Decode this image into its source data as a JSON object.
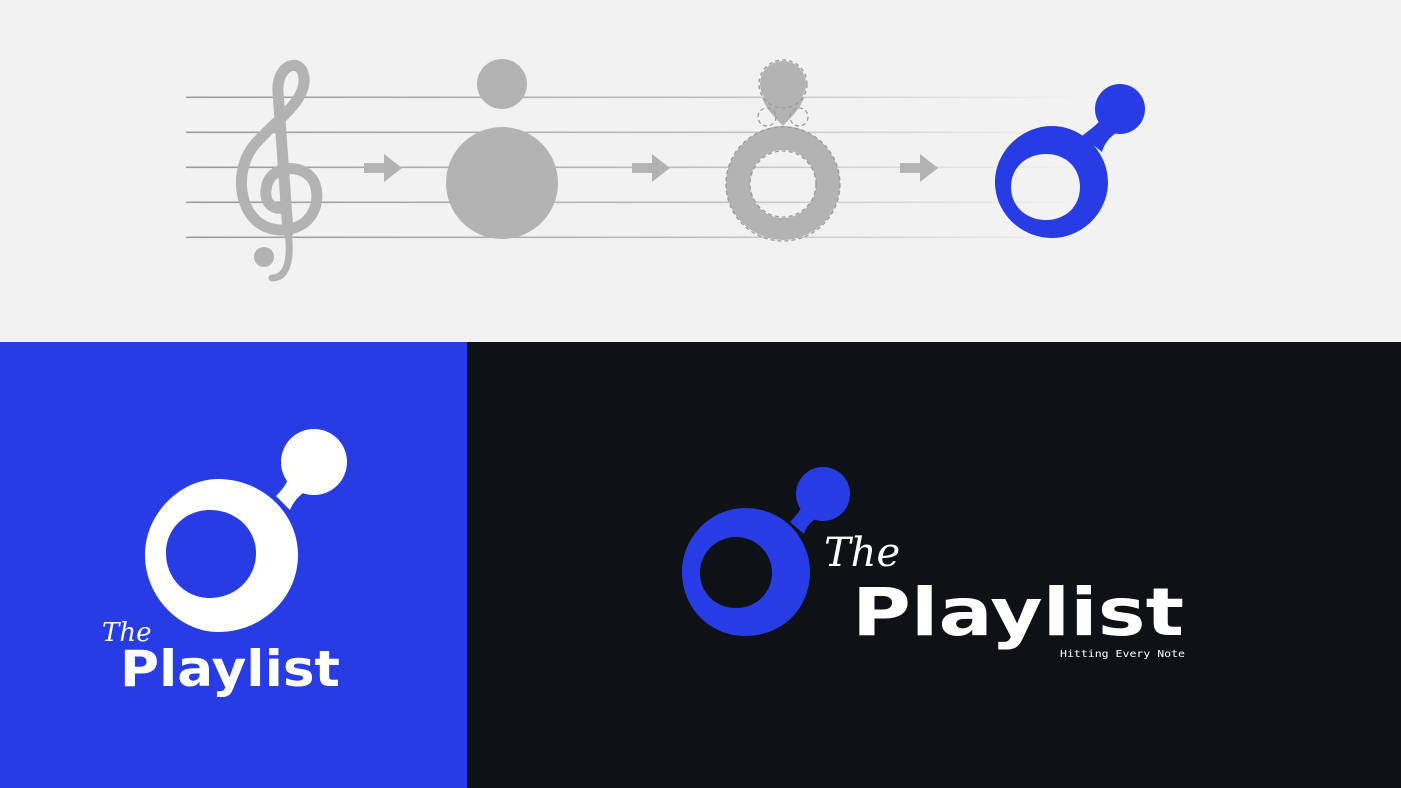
{
  "brand": {
    "prefix": "The",
    "name": "Playlist",
    "tagline": "Hitting Every Note"
  },
  "colors": {
    "brand_blue": "#273ce3",
    "dark": "#0e1115",
    "gray": "#b3b3b3",
    "light_bg": "#f2f2f2",
    "white": "#ffffff"
  },
  "icons": {
    "step1": "treble-clef-icon",
    "step2": "note-head-icon",
    "step3": "note-ring-construction-icon",
    "step4": "playlist-logo-mark-icon"
  }
}
